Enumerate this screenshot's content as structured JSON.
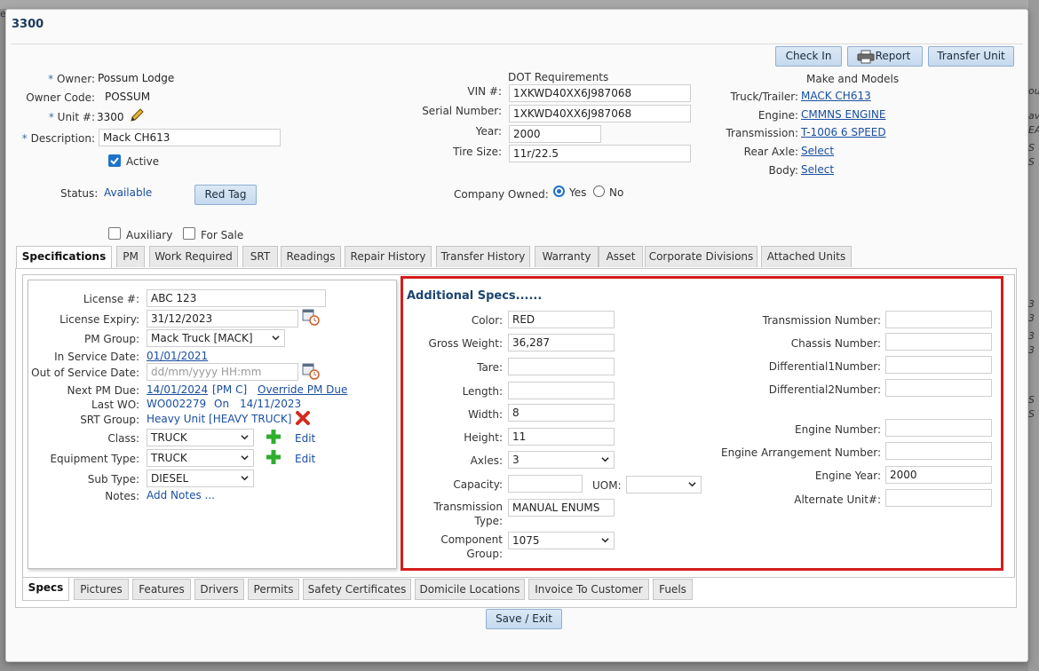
{
  "background": {
    "right_edge_texts": [
      "ou",
      "av",
      "EA",
      "S",
      "S",
      "3",
      "3",
      "3",
      "3",
      "S",
      "S"
    ],
    "left_edge_text": "e"
  },
  "dialog": {
    "title": "3300"
  },
  "toolbar": {
    "check_in": "Check In",
    "report": "Report",
    "transfer_unit": "Transfer Unit"
  },
  "owner": {
    "owner_label": "Owner:",
    "owner_value": "Possum Lodge",
    "owner_code_label": "Owner Code:",
    "owner_code_value": "POSSUM",
    "unit_label": "Unit #:",
    "unit_value": "3300",
    "description_label": "Description:",
    "description_value": "Mack CH613",
    "active_label": "Active",
    "status_label": "Status:",
    "status_value": "Available",
    "red_tag": "Red Tag",
    "auxiliary_label": "Auxiliary",
    "for_sale_label": "For Sale"
  },
  "dot": {
    "title": "DOT Requirements",
    "vin_label": "VIN #:",
    "vin_value": "1XKWD40XX6J987068",
    "serial_label": "Serial Number:",
    "serial_value": "1XKWD40XX6J987068",
    "year_label": "Year:",
    "year_value": "2000",
    "tire_label": "Tire Size:",
    "tire_value": "11r/22.5",
    "company_owned_label": "Company Owned:",
    "yes": "Yes",
    "no": "No"
  },
  "make": {
    "title": "Make and Models",
    "truck_label": "Truck/Trailer:",
    "truck_value": "MACK CH613",
    "engine_label": "Engine:",
    "engine_value": "CMMNS ENGINE",
    "transmission_label": "Transmission:",
    "transmission_value": "T-1006 6 SPEED",
    "rear_axle_label": "Rear Axle:",
    "rear_axle_value": "Select",
    "body_label": "Body:",
    "body_value": "Select"
  },
  "top_tabs": [
    "Specifications",
    "PM",
    "Work Required",
    "SRT",
    "Readings",
    "Repair History",
    "Transfer History",
    "Warranty",
    "Asset",
    "Corporate Divisions",
    "Attached Units"
  ],
  "specs_left": {
    "license_label": "License #:",
    "license_value": "ABC 123",
    "license_expiry_label": "License Expiry:",
    "license_expiry_value": "31/12/2023",
    "pm_group_label": "PM Group:",
    "pm_group_value": "Mack Truck [MACK]",
    "in_service_label": "In Service Date:",
    "in_service_value": "01/01/2021",
    "out_service_label": "Out of Service Date:",
    "out_service_placeholder": "dd/mm/yyyy HH:mm",
    "next_pm_label": "Next PM Due:",
    "next_pm_value": "14/01/2024",
    "next_pm_code": "[PM C]",
    "override_pm": "Override PM Due",
    "last_wo_label": "Last WO:",
    "last_wo_value": "WO002279",
    "last_wo_on": "On",
    "last_wo_date": "14/11/2023",
    "srt_group_label": "SRT Group:",
    "srt_group_value": "Heavy Unit [HEAVY TRUCK]",
    "class_label": "Class:",
    "class_value": "TRUCK",
    "class_edit": "Edit",
    "equip_type_label": "Equipment Type:",
    "equip_type_value": "TRUCK",
    "equip_edit": "Edit",
    "sub_type_label": "Sub Type:",
    "sub_type_value": "DIESEL",
    "notes_label": "Notes:",
    "notes_link": "Add Notes ..."
  },
  "additional": {
    "title": "Additional Specs......",
    "color_label": "Color:",
    "color_value": "RED",
    "gross_label": "Gross Weight:",
    "gross_value": "36,287",
    "tare_label": "Tare:",
    "tare_value": "",
    "length_label": "Length:",
    "length_value": "",
    "width_label": "Width:",
    "width_value": "8",
    "height_label": "Height:",
    "height_value": "11",
    "axles_label": "Axles:",
    "axles_value": "3",
    "capacity_label": "Capacity:",
    "capacity_value": "",
    "uom_label": "UOM:",
    "uom_value": "",
    "trans_type_label1": "Transmission",
    "trans_type_label2": "Type:",
    "trans_type_value": "MANUAL ENUMS",
    "comp_group_label1": "Component",
    "comp_group_label2": "Group:",
    "comp_group_value": "1075",
    "trans_num_label": "Transmission Number:",
    "chassis_label": "Chassis Number:",
    "diff1_label": "Differential1Number:",
    "diff2_label": "Differential2Number:",
    "engine_num_label": "Engine Number:",
    "engine_arr_label": "Engine Arrangement Number:",
    "engine_year_label": "Engine Year:",
    "engine_year_value": "2000",
    "alt_unit_label": "Alternate Unit#:"
  },
  "bottom_tabs": [
    "Specs",
    "Pictures",
    "Features",
    "Drivers",
    "Permits",
    "Safety Certificates",
    "Domicile Locations",
    "Invoice To Customer",
    "Fuels"
  ],
  "save_exit": "Save / Exit",
  "colors": {
    "accent": "#1f72c9",
    "highlight_box": "#d61c1c",
    "link": "#1a4fa0"
  }
}
